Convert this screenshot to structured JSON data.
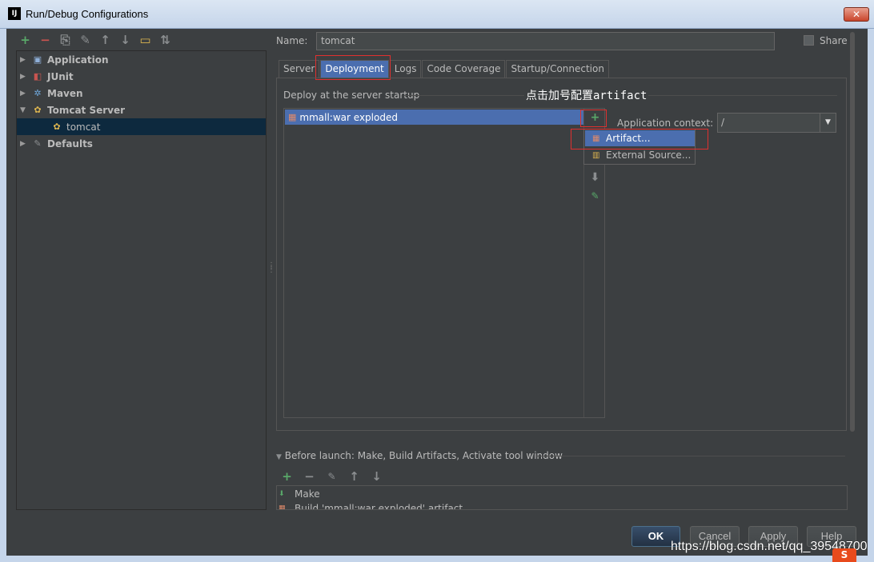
{
  "window": {
    "title": "Run/Debug Configurations",
    "app_badge": "IJ",
    "close_glyph": "✕"
  },
  "left_toolbar": [
    {
      "name": "add-icon",
      "glyph": "+"
    },
    {
      "name": "remove-icon",
      "glyph": "−"
    },
    {
      "name": "copy-icon",
      "glyph": "⎘"
    },
    {
      "name": "wrench-icon",
      "glyph": "✎"
    },
    {
      "name": "move-up-icon",
      "glyph": "↑"
    },
    {
      "name": "move-down-icon",
      "glyph": "↓"
    },
    {
      "name": "folder-icon",
      "glyph": "▭"
    },
    {
      "name": "sort-icon",
      "glyph": "⇅"
    }
  ],
  "tree": {
    "items": [
      {
        "label": "Application",
        "icon": "application-icon",
        "glyph": "▣"
      },
      {
        "label": "JUnit",
        "icon": "junit-icon",
        "glyph": "◧"
      },
      {
        "label": "Maven",
        "icon": "maven-icon",
        "glyph": "✲"
      },
      {
        "label": "Tomcat Server",
        "icon": "tomcat-icon",
        "glyph": "✿"
      },
      {
        "label": "tomcat",
        "icon": "tomcat-icon",
        "glyph": "✿"
      },
      {
        "label": "Defaults",
        "icon": "defaults-icon",
        "glyph": "✎"
      }
    ]
  },
  "form": {
    "name_label": "Name:",
    "name_value": "tomcat",
    "share_label": "Share"
  },
  "tabs": [
    "Server",
    "Deployment",
    "Logs",
    "Code Coverage",
    "Startup/Connection"
  ],
  "deployment": {
    "section_label": "Deploy at the server startup",
    "annotation": "点击加号配置artifact",
    "items": [
      "mmall:war exploded"
    ],
    "popup": [
      "Artifact...",
      "External Source..."
    ],
    "context_label": "Application context:",
    "context_value": "/"
  },
  "before_launch": {
    "header": "Before launch: Make, Build Artifacts, Activate tool window",
    "items": [
      "Make",
      "Build 'mmall:war exploded' artifact"
    ]
  },
  "buttons": {
    "ok": "OK",
    "cancel": "Cancel",
    "apply": "Apply",
    "help": "Help"
  },
  "watermark": "https://blog.csdn.net/qq_39548700",
  "watermark_badge": "S",
  "colors": {
    "selection": "#4b6eaf",
    "highlight_box": "#e0302f",
    "add_green": "#59a869"
  }
}
